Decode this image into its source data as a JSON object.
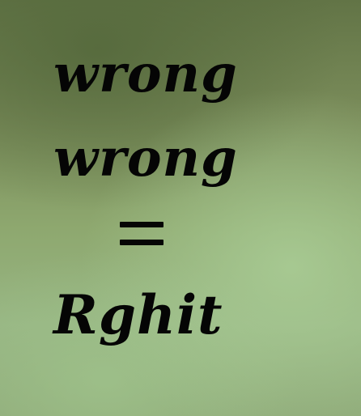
{
  "text": {
    "line1": "wrong",
    "line2": "wrong",
    "operator": "=",
    "line3": "Rghit"
  },
  "colors": {
    "text": "#050505",
    "background_dark": "#627446",
    "background_light": "#97b583"
  }
}
